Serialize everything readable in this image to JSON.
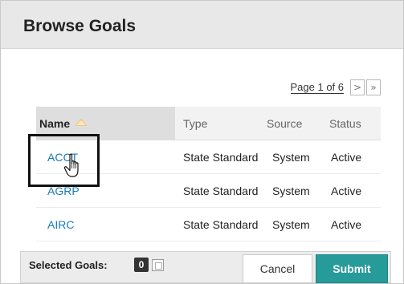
{
  "dialog": {
    "title": "Browse Goals"
  },
  "pager": {
    "text": "Page 1 of 6",
    "next_icon": "chevron-right-icon",
    "last_icon": "double-chevron-right-icon",
    "next_glyph": ">",
    "last_glyph": "»"
  },
  "table": {
    "headers": {
      "name": "Name",
      "type": "Type",
      "source": "Source",
      "status": "Status"
    },
    "sort": {
      "column": "Name",
      "direction": "ascending",
      "icon": "sort-ascending-icon"
    },
    "rows": [
      {
        "name": "ACCT",
        "type": "State Standard",
        "source": "System",
        "status": "Active"
      },
      {
        "name": "AGRP",
        "type": "State Standard",
        "source": "System",
        "status": "Active"
      },
      {
        "name": "AIRC",
        "type": "State Standard",
        "source": "System",
        "status": "Active"
      }
    ]
  },
  "footer": {
    "selected_label": "Selected Goals:",
    "selected_count": "0",
    "cancel_label": "Cancel",
    "submit_label": "Submit"
  },
  "colors": {
    "link": "#1a7bb9",
    "submit_bg": "#269b9a",
    "header_bg": "#e8e8e8",
    "highlight_border": "#111111"
  }
}
